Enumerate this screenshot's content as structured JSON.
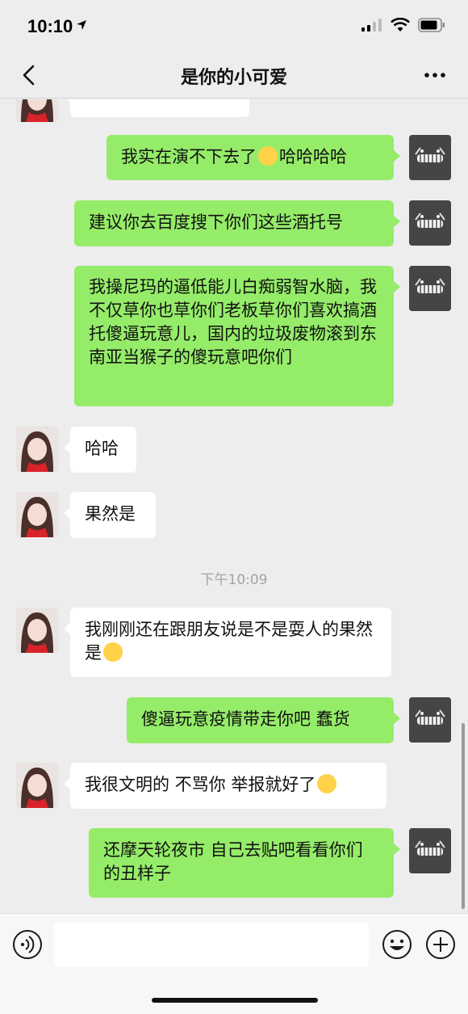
{
  "status_bar": {
    "time": "10:10"
  },
  "nav": {
    "title": "是你的小可爱"
  },
  "messages": [
    {
      "side": "in",
      "text": ""
    },
    {
      "side": "out",
      "text_before": "我实在演不下去了",
      "emoji": "tears-of-joy-emoji",
      "text_after": "哈哈哈哈"
    },
    {
      "side": "out",
      "text": "建议你去百度搜下你们这些酒托号"
    },
    {
      "side": "out",
      "text": "我操尼玛的逼低能儿白痴弱智水脑，我不仅草你也草你们老板草你们喜欢搞酒托傻逼玩意儿，国内的垃圾废物滚到东南亚当猴子的傻玩意吧你们"
    },
    {
      "side": "in",
      "text": "哈哈"
    },
    {
      "side": "in",
      "text": "果然是"
    },
    {
      "side": "in",
      "text_before": "我刚刚还在跟朋友说是不是耍人的果然是",
      "emoji": "blush-emoji",
      "text_after": ""
    },
    {
      "side": "out",
      "text": "傻逼玩意疫情带走你吧 蠢货"
    },
    {
      "side": "in",
      "text_before": "我很文明的 不骂你 举报就好了",
      "emoji": "kissing-emoji",
      "text_after": ""
    },
    {
      "side": "out",
      "text": "还摩天轮夜市 自己去贴吧看看你们的丑样子"
    }
  ],
  "timestamp": "下午10:09",
  "input": {
    "placeholder": ""
  },
  "colors": {
    "background": "#ededed",
    "outgoing_bubble": "#95ec69",
    "incoming_bubble": "#ffffff"
  }
}
